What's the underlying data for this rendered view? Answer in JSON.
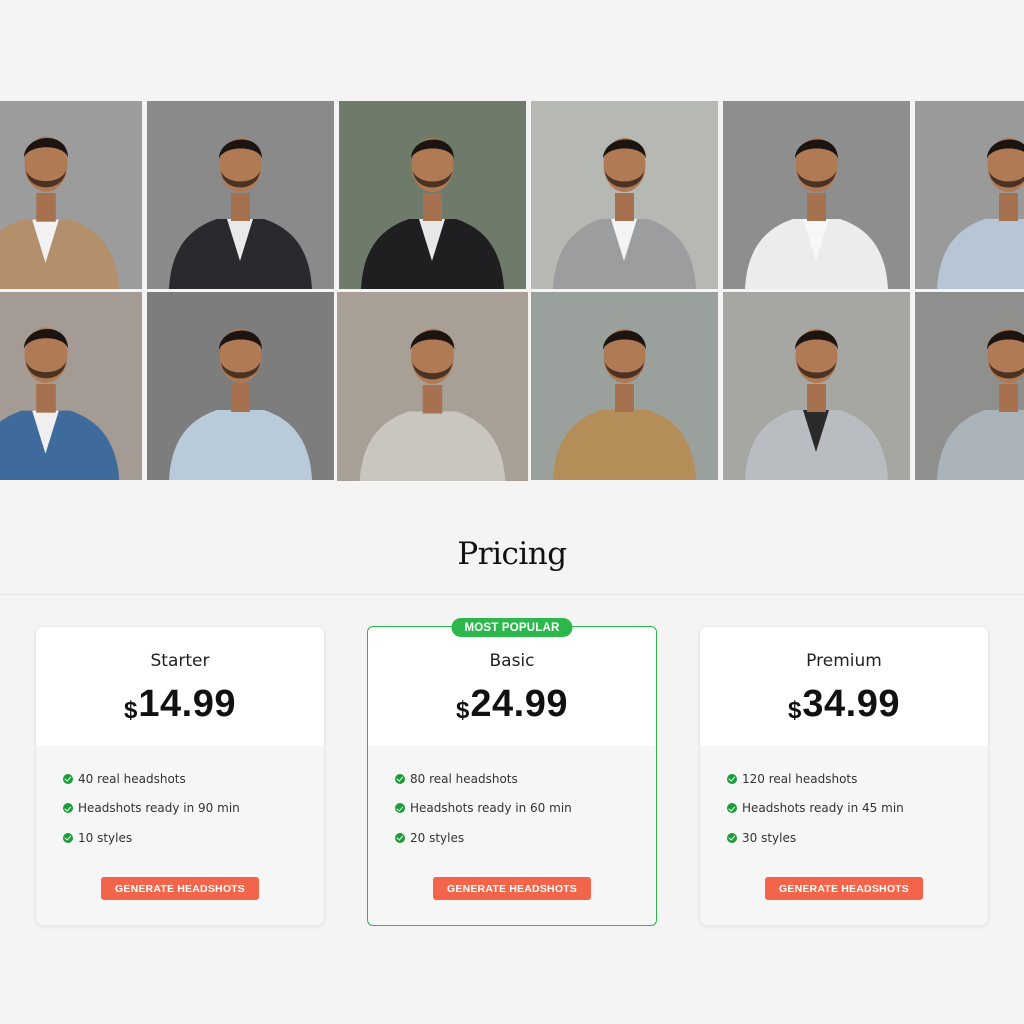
{
  "gallery": {
    "photos": [
      {
        "bg": "#9c9c9c",
        "outfit": "#b38f6c",
        "shirt": "#f2f2f2",
        "alt": "man-in-tan-blazer"
      },
      {
        "bg": "#8a8a8a",
        "outfit": "#2a2a2e",
        "shirt": "#e9e9e9",
        "alt": "man-in-dark-suit"
      },
      {
        "bg": "#6f7b6a",
        "outfit": "#1f1f22",
        "shirt": "#e8e8e8",
        "alt": "man-in-black-blazer"
      },
      {
        "bg": "#b6b8b3",
        "outfit": "#9c9d9f",
        "shirt": "#f3f3f3",
        "alt": "man-in-grey-blazer"
      },
      {
        "bg": "#8e8e8e",
        "outfit": "#ececec",
        "shirt": "#f7f7f7",
        "alt": "man-in-white-blazer"
      },
      {
        "bg": "#9a9a9a",
        "outfit": "#b6c6d6",
        "shirt": "#b6c6d6",
        "alt": "man-in-light-blue-shirt"
      },
      {
        "bg": "#a49c94",
        "outfit": "#3f6b9c",
        "shirt": "#efefef",
        "alt": "man-in-denim-jacket"
      },
      {
        "bg": "#7d7d7d",
        "outfit": "#b9cadb",
        "shirt": "#b9cadb",
        "alt": "man-in-blue-oxford"
      },
      {
        "bg": "#a89f96",
        "outfit": "#c9c5bf",
        "shirt": "#c9c5bf",
        "alt": "man-in-grey-shirt"
      },
      {
        "bg": "#9aa09b",
        "outfit": "#b48d58",
        "shirt": "#b48d58",
        "alt": "man-in-tan-shirt"
      },
      {
        "bg": "#a6a7a3",
        "outfit": "#b9bcc0",
        "shirt": "#2a2a2a",
        "alt": "man-in-patterned-shirt"
      },
      {
        "bg": "#8f8f8d",
        "outfit": "#aab2ba",
        "shirt": "#aab2ba",
        "alt": "man-in-grey-patterned-shirt"
      }
    ]
  },
  "pricing": {
    "title": "Pricing",
    "plans": [
      {
        "name": "Starter",
        "currency": "$",
        "amount": "14.99",
        "features": [
          "40 real headshots",
          "Headshots ready in 90 min",
          "10 styles"
        ],
        "cta": "GENERATE HEADSHOTS"
      },
      {
        "name": "Basic",
        "badge": "MOST POPULAR",
        "currency": "$",
        "amount": "24.99",
        "features": [
          "80 real headshots",
          "Headshots ready in 60 min",
          "20 styles"
        ],
        "cta": "GENERATE HEADSHOTS"
      },
      {
        "name": "Premium",
        "currency": "$",
        "amount": "34.99",
        "features": [
          "120 real headshots",
          "Headshots ready in 45 min",
          "30 styles"
        ],
        "cta": "GENERATE HEADSHOTS"
      }
    ]
  },
  "colors": {
    "accent_green": "#2db84d",
    "check_green": "#1a9e38",
    "cta_orange": "#f2654a",
    "page_bg": "#f4f4f4"
  }
}
